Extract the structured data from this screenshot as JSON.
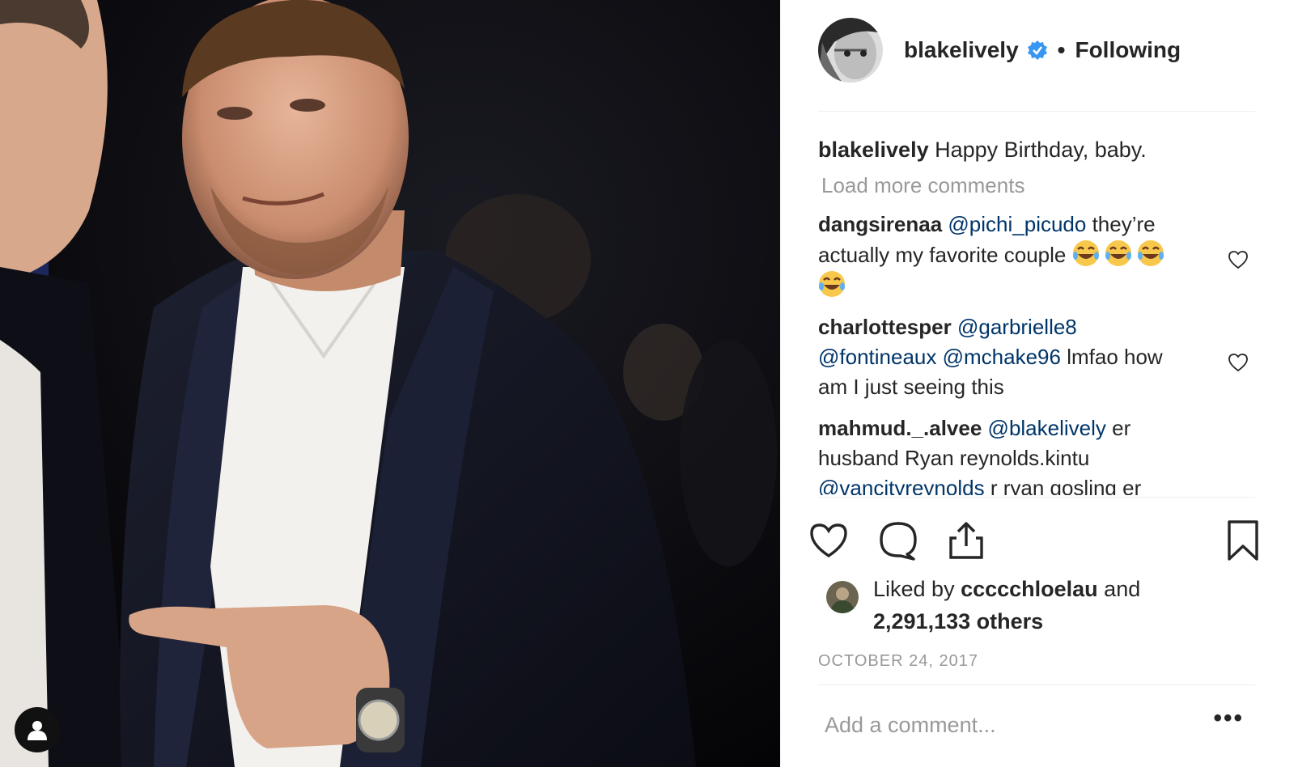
{
  "post": {
    "author": {
      "username": "blakelively",
      "verified_icon": "verified-badge-icon",
      "separator": "•",
      "follow_status": "Following"
    },
    "caption": {
      "username": "blakelively",
      "text": " Happy Birthday, baby."
    },
    "load_more_label": "Load more comments",
    "comments": [
      {
        "username": "dangsirenaa",
        "mentions": [
          "@pichi_picudo"
        ],
        "text_line1_rest": " they’re",
        "text_line2": "actually my favorite couple ",
        "emoji": [
          "tears-of-joy-emoji",
          "tears-of-joy-emoji",
          "tears-of-joy-emoji",
          "tears-of-joy-emoji"
        ]
      },
      {
        "username": "charlottesper",
        "mention1": "@garbrielle8",
        "mention2": "@fontineaux",
        "mention3": "@mchake96",
        "text_rest": " lmfao how",
        "text_line3": "am I just seeing this"
      },
      {
        "username": "mahmud._.alvee",
        "mention1": "@blakelively",
        "text1": " er",
        "text2": "husband Ryan reynolds.kintu",
        "mention2": "@vancityreynolds",
        "text3": " r ryan gosling er"
      }
    ],
    "likes": {
      "prefix": "Liked by ",
      "liker": "ccccchloelau",
      "mid": " and",
      "count": "2,291,133 others"
    },
    "date": "OCTOBER 24, 2017",
    "add_comment_placeholder": "Add a comment...",
    "more_options": "•••",
    "icons": {
      "like": "heart-icon",
      "comment": "comment-bubble-icon",
      "share": "share-icon",
      "save": "bookmark-icon",
      "tag": "user-tag-icon"
    },
    "colors": {
      "verified": "#3897f0",
      "mention": "#003569",
      "muted": "#999999",
      "text": "#262626",
      "divider": "#efefef"
    }
  }
}
